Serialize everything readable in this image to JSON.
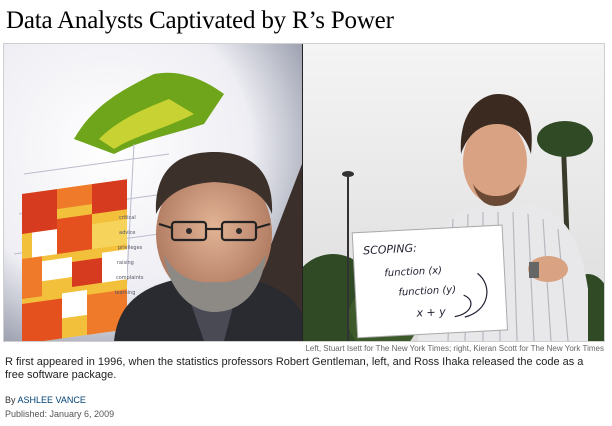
{
  "article": {
    "headline": "Data Analysts Captivated by R’s Power",
    "photo_credit": "Left, Stuart Isett for The New York Times; right, Kieran Scott for The New York Times",
    "caption": "R first appeared in 1996, when the statistics professors Robert Gentleman, left, and Ross Ihaka released the code as a free software package.",
    "byline_prefix": "By",
    "author": "ASHLEE VANCE",
    "published": "Published: January 6, 2009"
  },
  "whiteboard": {
    "title": "SCOPING:",
    "line1": "function (x)",
    "line2": "function (y)",
    "line3": "x + y"
  },
  "slide": {
    "labels": [
      "critical",
      "advice",
      "privileges",
      "raising",
      "complaints",
      "learning"
    ],
    "colors": {
      "heat_dark": "#c0392b",
      "heat_mid": "#ef7a2a",
      "heat_light": "#f6c03a",
      "surface": "#7fb81e"
    }
  }
}
